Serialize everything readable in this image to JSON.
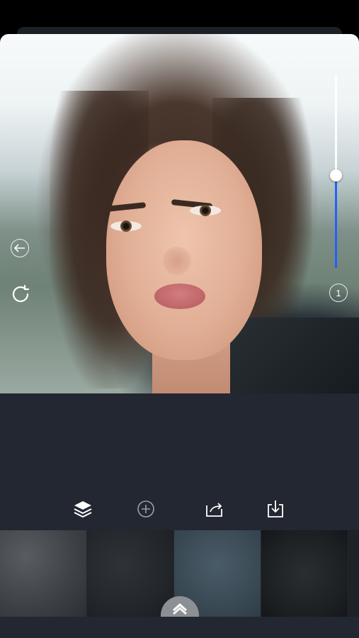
{
  "editor": {
    "photo_label": "portrait-photo",
    "undo_icon": "back-arrow-icon",
    "rotate_icon": "rotate-icon",
    "layer_count": "1",
    "intensity": 0.48,
    "accent_color": "#1e63ff"
  },
  "toolbar": {
    "icons": [
      "layers-icon",
      "add-icon",
      "share-icon",
      "download-icon"
    ]
  },
  "textures": {
    "items": [
      "texture-1",
      "texture-2",
      "texture-3",
      "texture-4"
    ]
  }
}
